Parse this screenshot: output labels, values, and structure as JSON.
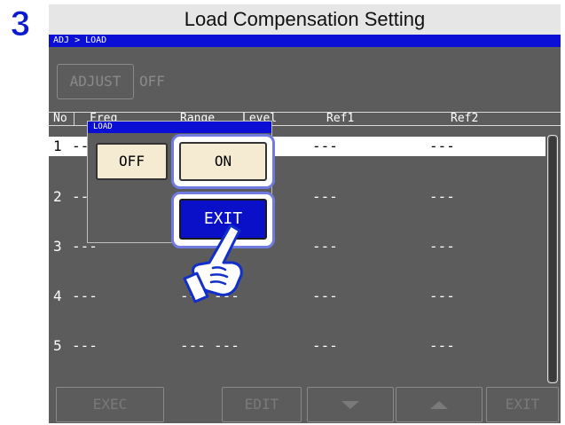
{
  "step_number": "3",
  "title": "Load Compensation Setting",
  "breadcrumb": "ADJ > LOAD",
  "adjust": {
    "button_label": "ADJUST",
    "value": "OFF"
  },
  "table": {
    "headers": [
      "No",
      "Freq",
      "Range",
      "Level",
      "Ref1",
      "Ref2"
    ],
    "rows": [
      {
        "no": "1",
        "freq": "---",
        "range": "---",
        "level": "---",
        "ref1": "---",
        "ref2": "---"
      },
      {
        "no": "2",
        "freq": "---",
        "range": "---",
        "level": "---",
        "ref1": "---",
        "ref2": "---"
      },
      {
        "no": "3",
        "freq": "---",
        "range": "---",
        "level": "---",
        "ref1": "---",
        "ref2": "---"
      },
      {
        "no": "4",
        "freq": "---",
        "range": "---",
        "level": "---",
        "ref1": "---",
        "ref2": "---"
      },
      {
        "no": "5",
        "freq": "---",
        "range": "---",
        "level": "---",
        "ref1": "---",
        "ref2": "---"
      }
    ]
  },
  "footer": {
    "exec": "EXEC",
    "edit": "EDIT",
    "exit": "EXIT"
  },
  "popup": {
    "title": "LOAD",
    "off_label": "OFF",
    "on_label": "ON",
    "exit_label": "EXIT"
  },
  "colors": {
    "accent_blue": "#0b0fd6",
    "button_cream": "#f5ebd2",
    "screen_bg": "#5c5c5c",
    "highlight_ring": "#6f7be0"
  }
}
